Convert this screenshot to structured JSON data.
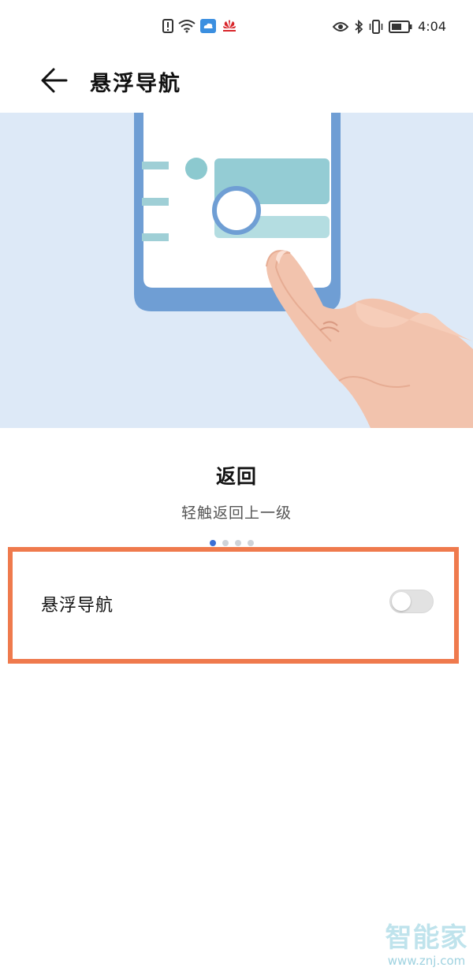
{
  "status_bar": {
    "time": "4:04",
    "notification_icons": [
      "alert-icon",
      "wifi-icon",
      "cloud-icon",
      "huawei-icon"
    ],
    "system_icons": [
      "eye-icon",
      "bluetooth-icon",
      "vibrate-icon",
      "battery-icon"
    ]
  },
  "header": {
    "title": "悬浮导航"
  },
  "gesture": {
    "title": "返回",
    "description": "轻触返回上一级",
    "pages_total": 4,
    "page_current": 1
  },
  "setting": {
    "label": "悬浮导航",
    "enabled": false
  },
  "watermark": {
    "text": "智能家",
    "url": "www.znj.com"
  },
  "colors": {
    "illustration_bg": "#dde9f7",
    "highlight_border": "#ef7a4d",
    "pager_active": "#3a6fd6"
  }
}
